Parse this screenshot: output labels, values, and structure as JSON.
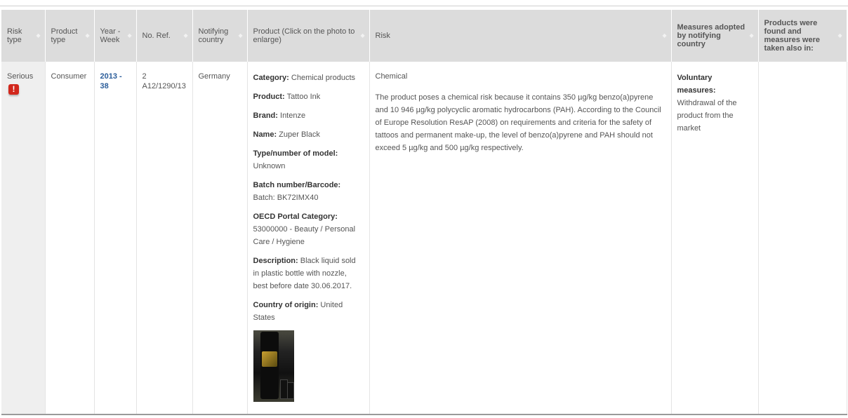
{
  "headers": [
    {
      "label": "Risk type"
    },
    {
      "label": "Product type"
    },
    {
      "label": "Year - Week"
    },
    {
      "label": "No. Ref."
    },
    {
      "label": "Notifying country"
    },
    {
      "label": "Product (Click on the photo to enlarge)"
    },
    {
      "label": "Risk"
    },
    {
      "label": "Measures adopted by notifying country"
    },
    {
      "label": "Products were found and measures were taken also in:"
    }
  ],
  "row": {
    "risk_type": "Serious",
    "risk_icon": "!",
    "product_type": "Consumer",
    "year_week": "2013 - 38",
    "ref_no": "2",
    "ref_code": "A12/1290/13",
    "notifying_country": "Germany",
    "product": {
      "category_label": "Category:",
      "category": " Chemical products",
      "product_label": "Product:",
      "product": " Tattoo Ink",
      "brand_label": "Brand:",
      "brand": " Intenze",
      "name_label": "Name:",
      "name": " Zuper Black",
      "model_label": "Type/number of model:",
      "model": "Unknown",
      "batch_label": "Batch number/Barcode:",
      "batch": "Batch: BK72IMX40",
      "oecd_label": "OECD Portal Category:",
      "oecd": "53000000 - Beauty / Personal Care / Hygiene",
      "description_label": "Description:",
      "description": " Black liquid sold in plastic bottle with nozzle, best before date 30.06.2017.",
      "origin_label": "Country of origin:",
      "origin": " United States"
    },
    "risk_category": "Chemical",
    "risk_description": "The product poses a chemical risk because it contains 350 µg/kg benzo(a)pyrene and 10 946 µg/kg polycyclic aromatic hydrocarbons (PAH). According to the Council of Europe Resolution ResAP (2008) on requirements and criteria for the safety of tattoos and permanent make-up, the level of benzo(a)pyrene and PAH should not exceed 5 µg/kg and 500 µg/kg respectively.",
    "measures_label": "Voluntary measures:",
    "measures": "Withdrawal of the product from the market",
    "also_in": ""
  },
  "colors": {
    "link": "#2b5d9a",
    "warning": "#d2271c",
    "header_bg": "#dcdcdc"
  }
}
